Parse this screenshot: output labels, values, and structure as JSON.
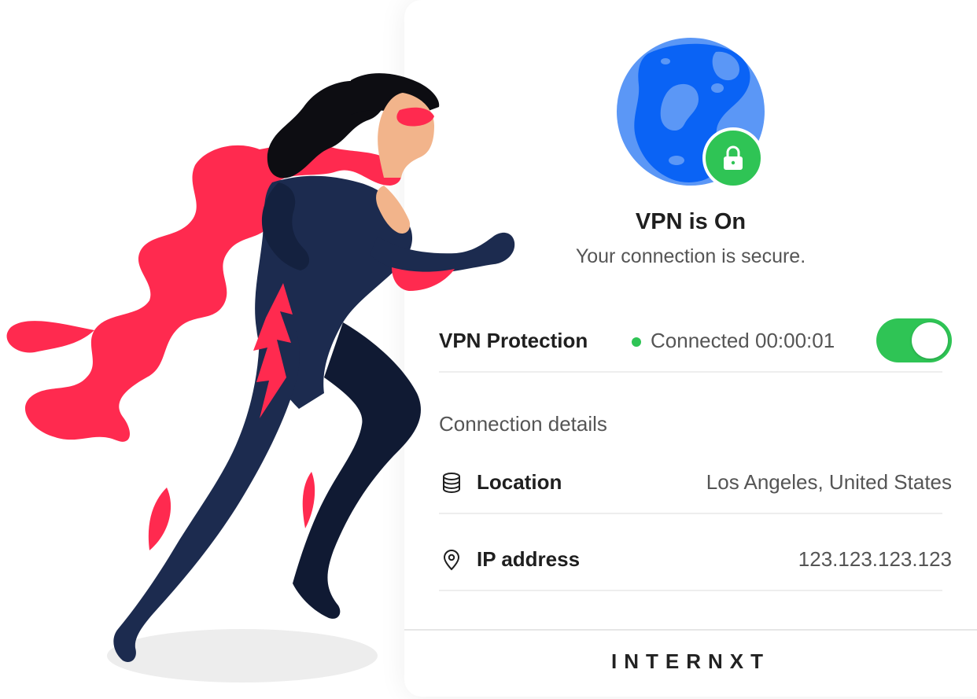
{
  "status": {
    "title": "VPN is On",
    "subtitle": "Your connection is secure."
  },
  "protection": {
    "label": "VPN Protection",
    "status_text": "Connected 00:00:01",
    "toggle_on": true
  },
  "details": {
    "heading": "Connection details",
    "location": {
      "label": "Location",
      "value": "Los Angeles, United States",
      "icon": "database-icon"
    },
    "ip": {
      "label": "IP address",
      "value": "123.123.123.123",
      "icon": "map-pin-icon"
    }
  },
  "footer": {
    "brand": "INTERNXT"
  },
  "colors": {
    "accent_green": "#2fc455",
    "globe_dark": "#0a63f5",
    "globe_light": "#5b97f6",
    "hero_red": "#ff2a4f",
    "hero_suit": "#1c2b4f"
  }
}
